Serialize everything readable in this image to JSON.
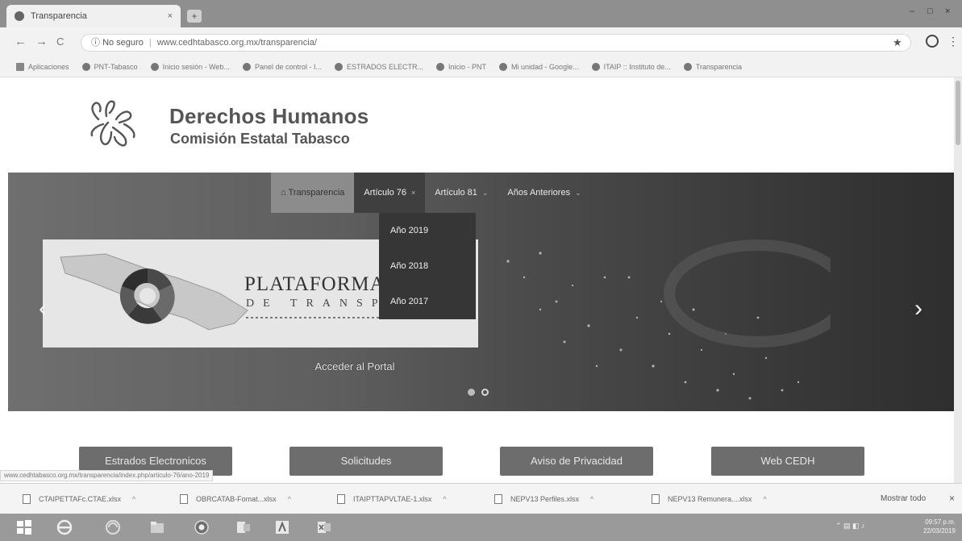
{
  "browser": {
    "tab_title": "Transparencia",
    "tab_close": "×",
    "new_tab": "+",
    "window_controls": [
      "–",
      "□",
      "×"
    ],
    "back": "←",
    "forward": "→",
    "reload": "C",
    "security_label": "No seguro",
    "url": "www.cedhtabasco.org.mx/transparencia/",
    "star": "★",
    "menu": "⋮",
    "bookmarks": [
      {
        "label": "Aplicaciones",
        "kind": "apps"
      },
      {
        "label": "PNT-Tabasco",
        "kind": "globe"
      },
      {
        "label": "Inicio sesión - Web...",
        "kind": "mail"
      },
      {
        "label": "Panel de control - I...",
        "kind": "globe"
      },
      {
        "label": "ESTRADOS ELECTR...",
        "kind": "globe"
      },
      {
        "label": "Inicio - PNT",
        "kind": "globe"
      },
      {
        "label": "Mi unidad - Google...",
        "kind": "drive"
      },
      {
        "label": "ITAIP :: Instituto de...",
        "kind": "globe"
      },
      {
        "label": "Transparencia",
        "kind": "globe"
      }
    ]
  },
  "site": {
    "title": "Derechos Humanos",
    "subtitle": "Comisión Estatal Tabasco",
    "nav": [
      {
        "label": "Transparencia",
        "icon": "home-icon"
      },
      {
        "label": "Artículo 76",
        "caret": "×"
      },
      {
        "label": "Artículo 81",
        "caret": "⌄"
      },
      {
        "label": "Años Anteriores",
        "caret": "⌄"
      }
    ],
    "dropdown": [
      "Año 2019",
      "Año 2018",
      "Año 2017"
    ],
    "banner": {
      "title": "PLATAFORMA N",
      "subtitle": "DE  TRANSPA",
      "button": "Acceder al Portal"
    },
    "carousel_prev": "‹",
    "carousel_next": "›",
    "quick_links": [
      "Estrados Electronicos",
      "Solicitudes",
      "Aviso de Privacidad",
      "Web CEDH"
    ],
    "status_url": "www.cedhtabasco.org.mx/transparencia/index.php/articulo-76/ano-2019"
  },
  "downloads": {
    "items": [
      "CTAIPETTAFc.CTAE.xlsx",
      "OBRCATAB-Fomat...xlsx",
      "ITAIPTTAPVLTAE-1.xlsx",
      "NEPV13 Perfiles.xlsx",
      "NEPV13 Remunera....xlsx"
    ],
    "caret": "^",
    "show_all": "Mostrar todo",
    "close": "×"
  },
  "taskbar": {
    "clock_time": "09:57 p.m.",
    "clock_date": "22/03/2019"
  },
  "colors": {
    "hero_dark": "#3a3a3a",
    "nav_active": "#8c8c8c",
    "dropdown_bg": "#363636",
    "button_bg": "#6d6d6d"
  }
}
